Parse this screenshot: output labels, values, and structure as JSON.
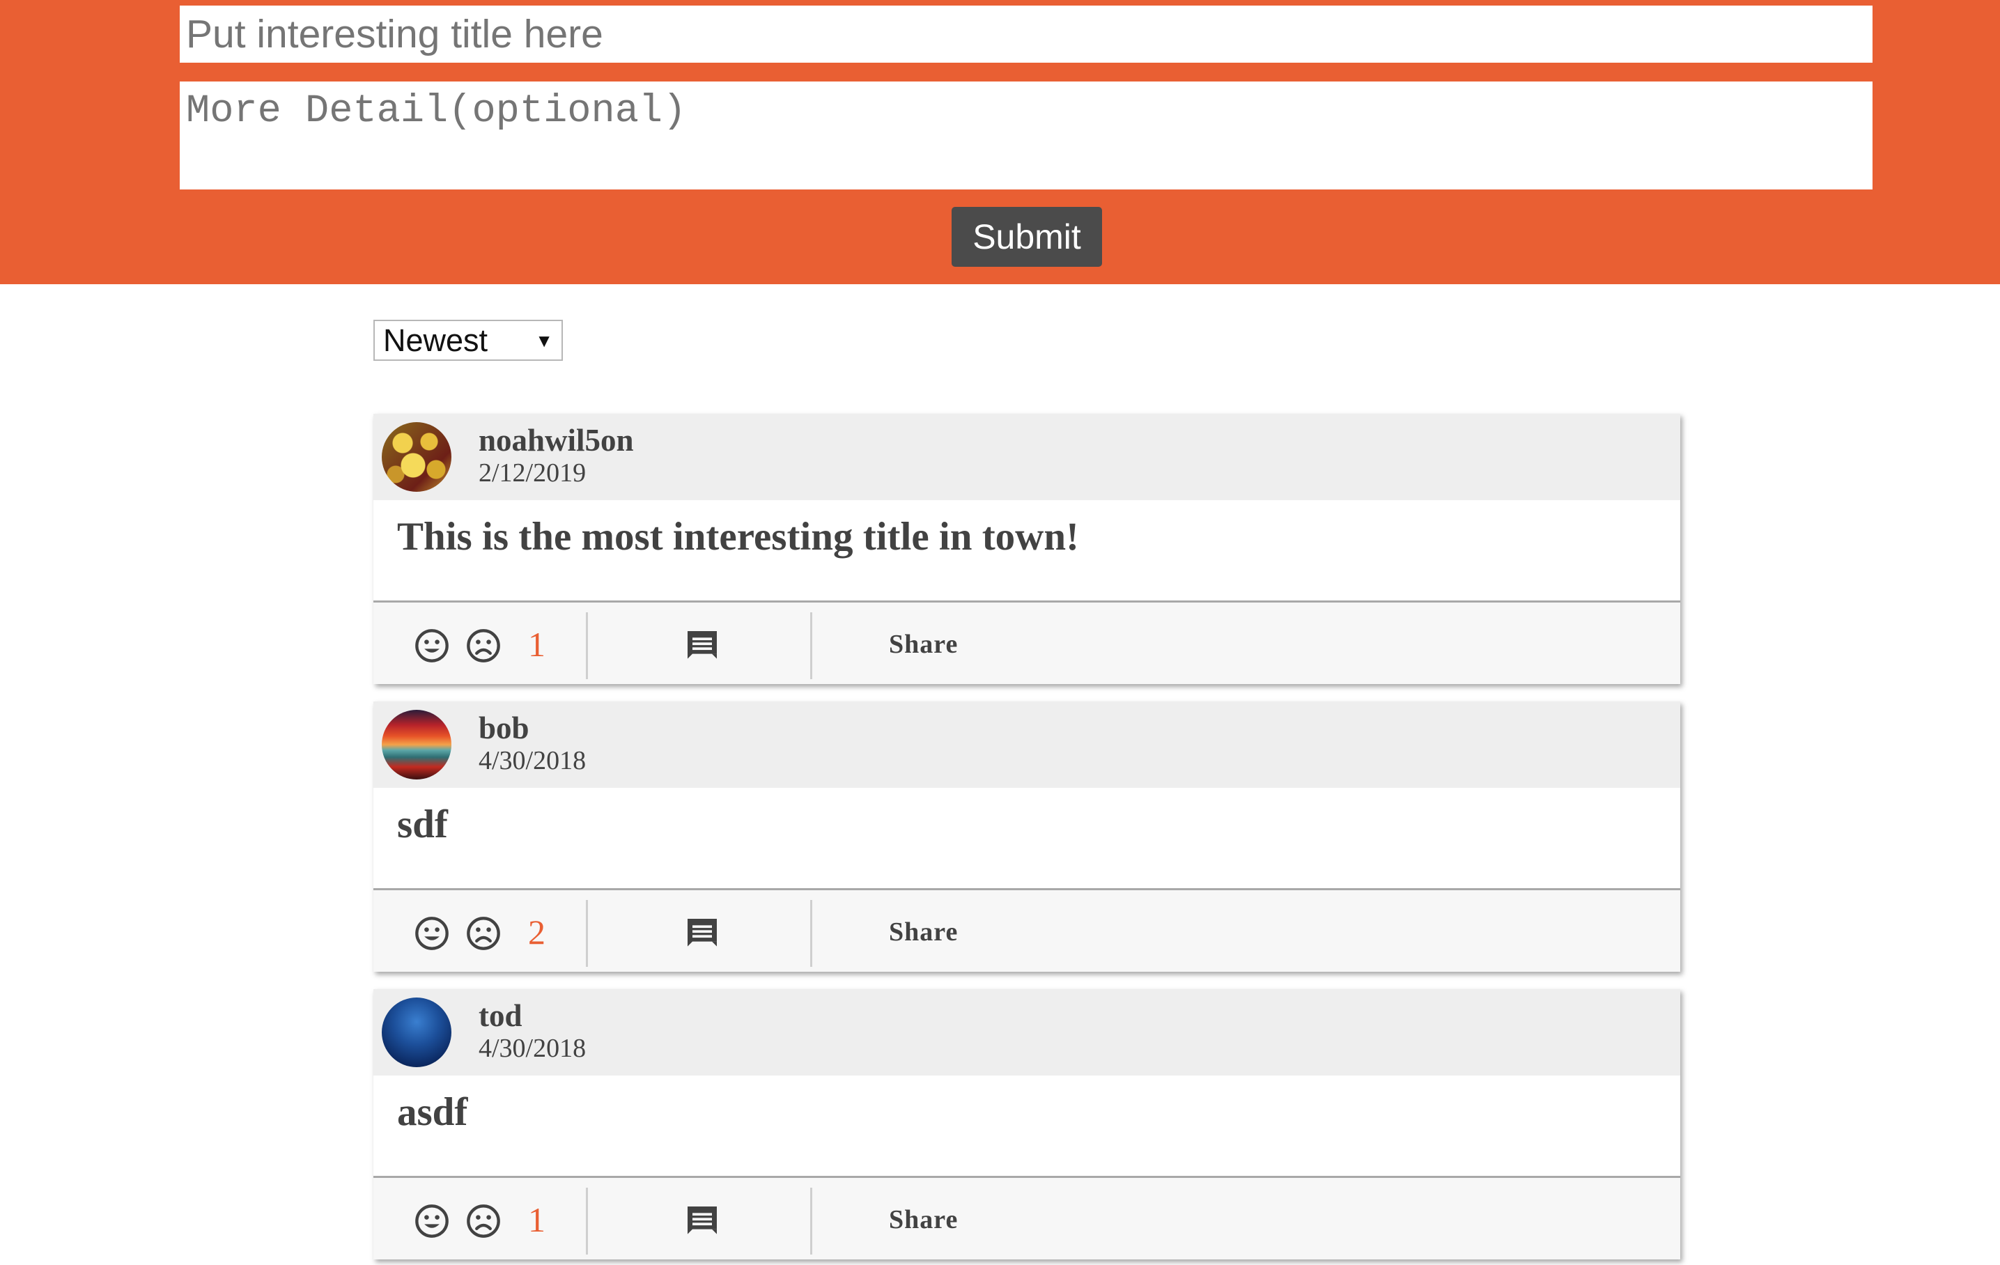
{
  "composer": {
    "title_placeholder": "Put interesting title here",
    "detail_placeholder": "More Detail(optional)",
    "submit_label": "Submit"
  },
  "sort": {
    "selected": "Newest"
  },
  "colors": {
    "accent": "#e95f33",
    "button": "#4b4b4b",
    "header_bg": "#eeeeee",
    "footer_bg": "#f7f7f7",
    "text": "#424242"
  },
  "posts": [
    {
      "username": "noahwil5on",
      "date": "2/12/2019",
      "title": "This is the most interesting title in town!",
      "score": "1",
      "share_label": "Share"
    },
    {
      "username": "bob",
      "date": "4/30/2018",
      "title": "sdf",
      "score": "2",
      "share_label": "Share"
    },
    {
      "username": "tod",
      "date": "4/30/2018",
      "title": "asdf",
      "score": "1",
      "share_label": "Share"
    }
  ]
}
